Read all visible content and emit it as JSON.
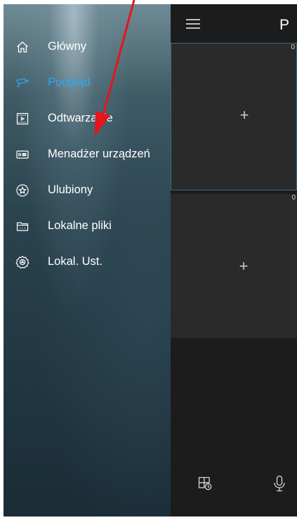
{
  "drawer": {
    "items": [
      {
        "label": "Główny",
        "icon": "home-icon",
        "active": false
      },
      {
        "label": "Podgląd",
        "icon": "camera-icon",
        "active": true
      },
      {
        "label": "Odtwarzanie",
        "icon": "playback-icon",
        "active": false
      },
      {
        "label": "Menadżer urządzeń",
        "icon": "device-manager-icon",
        "active": false
      },
      {
        "label": "Ulubiony",
        "icon": "star-icon",
        "active": false
      },
      {
        "label": "Lokalne pliki",
        "icon": "folder-icon",
        "active": false
      },
      {
        "label": "Lokal. Ust.",
        "icon": "settings-icon",
        "active": false
      }
    ]
  },
  "header": {
    "title": "P",
    "menu_icon": "hamburger-menu-icon"
  },
  "panes": [
    {
      "index": "0",
      "icon": "plus-icon"
    },
    {
      "index": "0",
      "icon": "plus-icon"
    }
  ],
  "bottom": {
    "playback_icon": "grid-clock-icon",
    "mic_icon": "microphone-icon"
  },
  "colors": {
    "active": "#2ea7ef",
    "annotation_arrow": "#e3161b",
    "content_bg": "#1c1c1c",
    "pane_bg": "#2a2a2a"
  }
}
